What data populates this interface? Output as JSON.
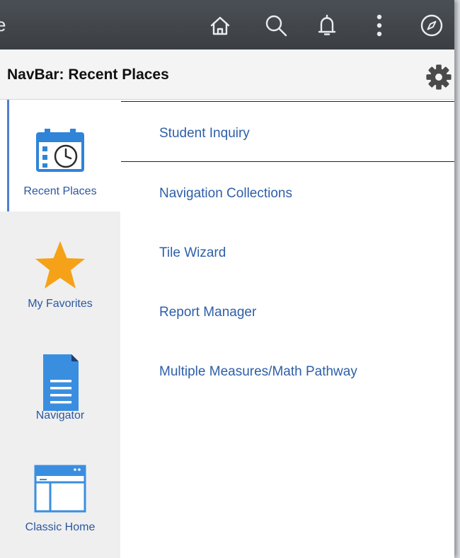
{
  "header": {
    "stub_text": "e",
    "icons": [
      "home-icon",
      "search-icon",
      "notification-bell-icon",
      "actions-menu-icon",
      "navbar-compass-icon"
    ]
  },
  "navbar": {
    "title": "NavBar: Recent Places"
  },
  "left_nav": {
    "items": [
      {
        "label": "Recent Places",
        "icon": "recent-places-calendar-clock-icon",
        "active": true
      },
      {
        "label": "My Favorites",
        "icon": "star-icon",
        "active": false
      },
      {
        "label": "Navigator",
        "icon": "document-icon",
        "active": false
      },
      {
        "label": "Classic Home",
        "icon": "browser-window-icon",
        "active": false
      }
    ]
  },
  "recent_places": {
    "items": [
      {
        "label": "Student Inquiry",
        "selected": true
      },
      {
        "label": "Navigation Collections",
        "selected": false
      },
      {
        "label": "Tile Wizard",
        "selected": false
      },
      {
        "label": "Report Manager",
        "selected": false
      },
      {
        "label": "Multiple Measures/Math Pathway",
        "selected": false
      }
    ]
  },
  "colors": {
    "header_bg": "#3f4348",
    "link": "#2d5fa8",
    "accent_blue": "#3a8ee0",
    "star": "#f5a219",
    "active_indicator": "#4f7fcf"
  }
}
